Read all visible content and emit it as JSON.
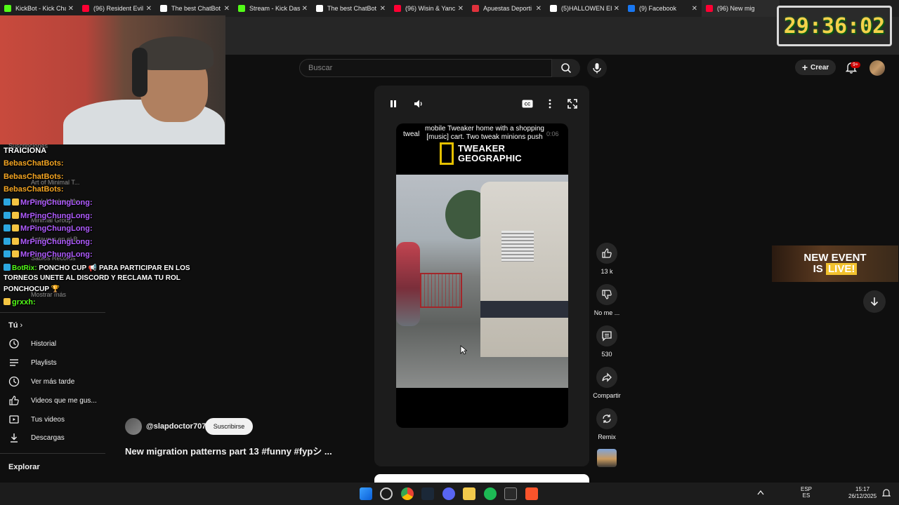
{
  "browser": {
    "tabs": [
      {
        "title": "KickBot - Kick Cha",
        "color": "#53fc18"
      },
      {
        "title": "(96) Resident Evil",
        "color": "#ff0033"
      },
      {
        "title": "The best ChatBot",
        "color": "#ffffff"
      },
      {
        "title": "Stream - Kick Das",
        "color": "#53fc18"
      },
      {
        "title": "The best ChatBot",
        "color": "#ffffff"
      },
      {
        "title": "(96) Wisin & Yanc",
        "color": "#ff0033"
      },
      {
        "title": "Apuestas Deporti",
        "color": "#e0323c"
      },
      {
        "title": "(5)HALLOWEN EI",
        "color": "#ffffff"
      },
      {
        "title": "(9) Facebook",
        "color": "#1877f2"
      },
      {
        "title": "(96) New mig",
        "color": "#ff0033"
      }
    ]
  },
  "youtube": {
    "search_placeholder": "Buscar",
    "create_label": "Crear",
    "notifications_badge": "9+"
  },
  "chat": {
    "lines": [
      {
        "user": "TRAICIONA",
        "msg": "",
        "color": "#ffffff"
      },
      {
        "user": "BebasChatBots:",
        "msg": "",
        "color": "#f5a623"
      },
      {
        "user": "BebasChatBots:",
        "msg": "",
        "color": "#f5a623"
      },
      {
        "user": "BebasChatBots:",
        "msg": "",
        "color": "#f5a623"
      },
      {
        "user": "MrPingChungLong:",
        "msg": "",
        "color": "#b05cff"
      },
      {
        "user": "MrPingChungLong:",
        "msg": "",
        "color": "#b05cff"
      },
      {
        "user": "MrPingChungLong:",
        "msg": "",
        "color": "#b05cff"
      },
      {
        "user": "MrPingChungLong:",
        "msg": "",
        "color": "#b05cff"
      },
      {
        "user": "MrPingChungLong:",
        "msg": "",
        "color": "#b05cff"
      },
      {
        "user": "BotRix:",
        "msg": "PONCHO CUP 📢 PARA PARTICIPAR EN LOS",
        "color": "#53fc18"
      },
      {
        "user": "",
        "msg": "TORNEOS UNETE AL DISCORD Y RECLAMA TU ROL",
        "color": "#ffffff"
      },
      {
        "user": "",
        "msg": "PONCHOCUP 🏆",
        "color": "#ffffff"
      },
      {
        "user": "grxxh:",
        "msg": "",
        "color": "#53fc18"
      }
    ],
    "ghost_items": [
      "Suscripciones",
      "Art of Minimal T...",
      "Dark Monkey Mu...",
      "Minimal Group",
      "Antaurus en el B...",
      "Sabios Records",
      "Mostrar más"
    ]
  },
  "sidebar": {
    "you_label": "Tú",
    "items": [
      {
        "label": "Historial",
        "icon": "history-icon"
      },
      {
        "label": "Playlists",
        "icon": "playlist-icon"
      },
      {
        "label": "Ver más tarde",
        "icon": "clock-icon"
      },
      {
        "label": "Videos que me gus...",
        "icon": "thumbs-up-icon"
      },
      {
        "label": "Tus videos",
        "icon": "video-icon"
      },
      {
        "label": "Descargas",
        "icon": "download-icon"
      }
    ],
    "explore_label": "Explorar"
  },
  "short": {
    "caption_left": "tweal",
    "caption": "mobile Tweaker home with a shopping [music] cart. Two tweak minions push",
    "timecode": "0:06",
    "logo_line1": "TWEAKER",
    "logo_line2": "GEOGRAPHIC",
    "channel": "@slapdoctor707",
    "subscribe_label": "Suscribirse",
    "title": "New migration patterns part 13 #funny #fypシ ...",
    "actions": {
      "likes": "13 k",
      "dislike_label": "No me ...",
      "comments": "530",
      "share_label": "Compartir",
      "remix_label": "Remix"
    }
  },
  "overlays": {
    "timer": "29:36:02",
    "event_line1": "NEW EVENT",
    "event_is": "IS",
    "event_live": "LIVE!"
  },
  "taskbar": {
    "lang_line1": "ESP",
    "lang_line2": "ES",
    "time": "15:17",
    "date": "26/12/2025"
  }
}
